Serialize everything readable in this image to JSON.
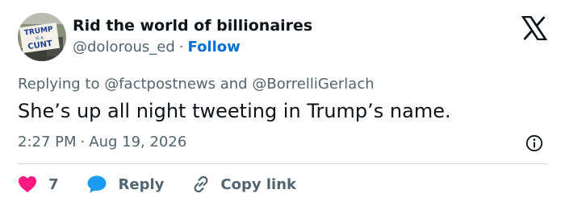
{
  "author": {
    "display_name": "Rid the world of billionaires",
    "handle": "@dolorous_ed",
    "separator": "·",
    "follow_label": "Follow",
    "avatar_sign_text": [
      "TRUMP",
      "IS A",
      "CUNT"
    ]
  },
  "brand_icon": "x-logo-icon",
  "reply_context": {
    "prefix": "Replying to",
    "users": [
      "@factpostnews",
      "@BorrelliGerlach"
    ],
    "joiner": "and"
  },
  "text": "She’s up all night tweeting in Trump’s name.",
  "meta": {
    "time": "2:27 PM",
    "separator": "·",
    "date": "Aug 19, 2026",
    "info_icon": "info-icon"
  },
  "actions": {
    "like": {
      "icon": "heart-icon",
      "count": "7"
    },
    "reply": {
      "icon": "speech-bubble-icon",
      "label": "Reply"
    },
    "copy_link": {
      "icon": "link-icon",
      "label": "Copy link"
    }
  },
  "colors": {
    "text": "#0f1419",
    "muted": "#536471",
    "link": "#006fd6",
    "like": "#f91880",
    "reply": "#1d9bf0",
    "divider": "#cfd9de"
  }
}
